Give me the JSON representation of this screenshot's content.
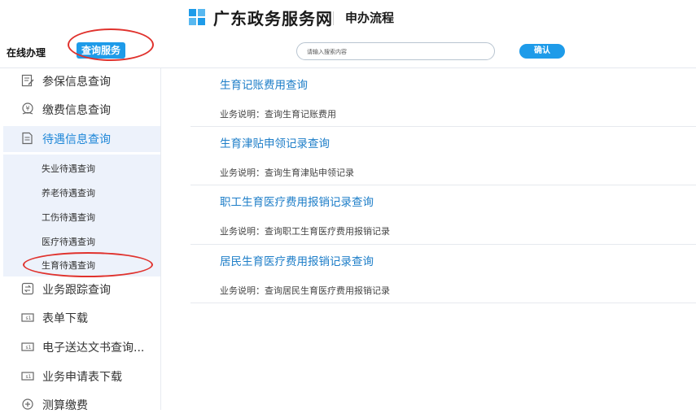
{
  "header": {
    "site_title": "广东政务服务网",
    "page_subtitle": "申办流程",
    "logo_icon": "gd-gov-logo-icon",
    "logo_color": "#1e9be9"
  },
  "topbar": {
    "tab_online": "在线办理",
    "tab_query": "查询服务",
    "search_placeholder": "请输入搜索内容",
    "confirm_label": "确认",
    "accent_color": "#1e9be9",
    "annotation_color": "#e0322d"
  },
  "sidebar": {
    "items": [
      {
        "label": "参保信息查询",
        "icon": "form-edit-icon"
      },
      {
        "label": "缴费信息查询",
        "icon": "coin-payment-icon"
      },
      {
        "label": "待遇信息查询",
        "icon": "document-icon",
        "active": true
      },
      {
        "label": "业务跟踪查询",
        "icon": "exchange-arrows-icon"
      },
      {
        "label": "表单下载",
        "icon": "download-box-icon"
      },
      {
        "label": "电子送达文书查询...",
        "icon": "download-box-icon"
      },
      {
        "label": "业务申请表下载",
        "icon": "download-box-icon"
      },
      {
        "label": "测算缴费",
        "icon": "calculator-icon"
      }
    ],
    "sub_items": [
      {
        "label": "失业待遇查询"
      },
      {
        "label": "养老待遇查询"
      },
      {
        "label": "工伤待遇查询"
      },
      {
        "label": "医疗待遇查询"
      },
      {
        "label": "生育待遇查询",
        "selected": true
      }
    ]
  },
  "services": [
    {
      "title": "生育记账费用查询",
      "desc": "业务说明：查询生育记账费用"
    },
    {
      "title": "生育津贴申领记录查询",
      "desc": "业务说明：查询生育津贴申领记录"
    },
    {
      "title": "职工生育医疗费用报销记录查询",
      "desc": "业务说明：查询职工生育医疗费用报销记录"
    },
    {
      "title": "居民生育医疗费用报销记录查询",
      "desc": "业务说明：查询居民生育医疗费用报销记录"
    }
  ]
}
